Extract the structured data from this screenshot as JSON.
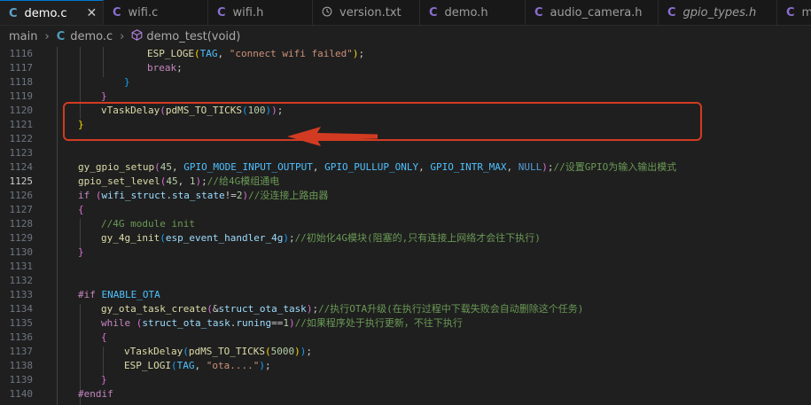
{
  "tabs": [
    {
      "icon": "C",
      "label": "demo.c",
      "active": true,
      "close": "✕",
      "italic": false,
      "width": 117
    },
    {
      "icon": "C",
      "label": "wifi.c",
      "active": false,
      "italic": false,
      "width": 118
    },
    {
      "icon": "C",
      "label": "wifi.h",
      "active": false,
      "italic": false,
      "width": 118
    },
    {
      "icon": "clock",
      "label": "version.txt",
      "active": false,
      "italic": false,
      "width": 121
    },
    {
      "icon": "C",
      "label": "demo.h",
      "active": false,
      "italic": false,
      "width": 119
    },
    {
      "icon": "C",
      "label": "audio_camera.h",
      "active": false,
      "italic": false,
      "width": 150
    },
    {
      "icon": "C",
      "label": "gpio_types.h",
      "active": false,
      "italic": true,
      "width": 134
    },
    {
      "icon": "C",
      "label": "m",
      "active": false,
      "italic": false,
      "width": 60
    }
  ],
  "breadcrumb": {
    "folder": "main",
    "file_icon": "C",
    "file": "demo.c",
    "symbol": "demo_test(void)"
  },
  "lines": [
    {
      "n": "1116",
      "indent": 3,
      "tokens": [
        [
          "fn",
          "ESP_LOGE"
        ],
        [
          "br1",
          "("
        ],
        [
          "mac",
          "TAG"
        ],
        [
          "txt",
          ", "
        ],
        [
          "str",
          "\"connect wifi failed\""
        ],
        [
          "br1",
          ")"
        ],
        [
          "txt",
          ";"
        ]
      ]
    },
    {
      "n": "1117",
      "indent": 3,
      "tokens": [
        [
          "kw",
          "break"
        ],
        [
          "txt",
          ";"
        ]
      ]
    },
    {
      "n": "1118",
      "indent": 2,
      "tokens": [
        [
          "br3",
          "}"
        ]
      ]
    },
    {
      "n": "1119",
      "indent": 1,
      "tokens": [
        [
          "br2",
          "}"
        ]
      ]
    },
    {
      "n": "1120",
      "indent": 1,
      "tokens": [
        [
          "fn",
          "vTaskDelay"
        ],
        [
          "br2",
          "("
        ],
        [
          "fn",
          "pdMS_TO_TICKS"
        ],
        [
          "br3",
          "("
        ],
        [
          "num",
          "100"
        ],
        [
          "br3",
          ")"
        ],
        [
          "br2",
          ")"
        ],
        [
          "txt",
          ";"
        ]
      ]
    },
    {
      "n": "1121",
      "indent": 0,
      "tokens": [
        [
          "br1",
          "}"
        ]
      ]
    },
    {
      "n": "1122",
      "indent": 0,
      "tokens": []
    },
    {
      "n": "1123",
      "indent": 0,
      "tokens": []
    },
    {
      "n": "1124",
      "indent": 0,
      "tokens": [
        [
          "fn",
          "gy_gpio_setup"
        ],
        [
          "br2",
          "("
        ],
        [
          "num",
          "45"
        ],
        [
          "txt",
          ", "
        ],
        [
          "mac",
          "GPIO_MODE_INPUT_OUTPUT"
        ],
        [
          "txt",
          ", "
        ],
        [
          "mac",
          "GPIO_PULLUP_ONLY"
        ],
        [
          "txt",
          ", "
        ],
        [
          "mac",
          "GPIO_INTR_MAX"
        ],
        [
          "txt",
          ", "
        ],
        [
          "kwb",
          "NULL"
        ],
        [
          "br2",
          ")"
        ],
        [
          "txt",
          ";"
        ],
        [
          "com",
          "//设置GPIO为输入输出模式"
        ]
      ]
    },
    {
      "n": "1125",
      "indent": 0,
      "current": true,
      "tokens": [
        [
          "fn",
          "gpio_set_level"
        ],
        [
          "br2",
          "("
        ],
        [
          "num",
          "45"
        ],
        [
          "txt",
          ", "
        ],
        [
          "num",
          "1"
        ],
        [
          "br2",
          ")"
        ],
        [
          "txt",
          ";"
        ],
        [
          "com",
          "//给4G模组通电"
        ]
      ]
    },
    {
      "n": "1126",
      "indent": 0,
      "tokens": [
        [
          "kw",
          "if"
        ],
        [
          "txt",
          " "
        ],
        [
          "br2",
          "("
        ],
        [
          "var",
          "wifi_struct"
        ],
        [
          "txt",
          "."
        ],
        [
          "var",
          "sta_state"
        ],
        [
          "txt",
          "!="
        ],
        [
          "num",
          "2"
        ],
        [
          "br2",
          ")"
        ],
        [
          "com",
          "//没连接上路由器"
        ]
      ]
    },
    {
      "n": "1127",
      "indent": 0,
      "tokens": [
        [
          "br2",
          "{"
        ]
      ]
    },
    {
      "n": "1128",
      "indent": 1,
      "tokens": [
        [
          "com",
          "//4G module init"
        ]
      ]
    },
    {
      "n": "1129",
      "indent": 1,
      "tokens": [
        [
          "fn",
          "gy_4g_init"
        ],
        [
          "br3",
          "("
        ],
        [
          "var",
          "esp_event_handler_4g"
        ],
        [
          "br3",
          ")"
        ],
        [
          "txt",
          ";"
        ],
        [
          "com",
          "//初始化4G模块(阻塞的,只有连接上网络才会往下执行)"
        ]
      ]
    },
    {
      "n": "1130",
      "indent": 0,
      "tokens": [
        [
          "br2",
          "}"
        ]
      ]
    },
    {
      "n": "1131",
      "indent": 0,
      "tokens": []
    },
    {
      "n": "1132",
      "indent": 0,
      "tokens": []
    },
    {
      "n": "1133",
      "indent": 0,
      "tokens": [
        [
          "kw",
          "#if"
        ],
        [
          "txt",
          " "
        ],
        [
          "mac",
          "ENABLE_OTA"
        ]
      ]
    },
    {
      "n": "1134",
      "indent": 1,
      "tokens": [
        [
          "fn",
          "gy_ota_task_create"
        ],
        [
          "br2",
          "("
        ],
        [
          "txt",
          "&"
        ],
        [
          "var",
          "struct_ota_task"
        ],
        [
          "br2",
          ")"
        ],
        [
          "txt",
          ";"
        ],
        [
          "com",
          "//执行OTA升级(在执行过程中下载失败会自动删除这个任务)"
        ]
      ]
    },
    {
      "n": "1135",
      "indent": 1,
      "tokens": [
        [
          "kw",
          "while"
        ],
        [
          "txt",
          " "
        ],
        [
          "br2",
          "("
        ],
        [
          "var",
          "struct_ota_task"
        ],
        [
          "txt",
          "."
        ],
        [
          "var",
          "runing"
        ],
        [
          "txt",
          "=="
        ],
        [
          "num",
          "1"
        ],
        [
          "br2",
          ")"
        ],
        [
          "com",
          "//如果程序处于执行更新，不往下执行"
        ]
      ]
    },
    {
      "n": "1136",
      "indent": 1,
      "tokens": [
        [
          "br2",
          "{"
        ]
      ]
    },
    {
      "n": "1137",
      "indent": 2,
      "tokens": [
        [
          "fn",
          "vTaskDelay"
        ],
        [
          "br3",
          "("
        ],
        [
          "fn",
          "pdMS_TO_TICKS"
        ],
        [
          "br1",
          "("
        ],
        [
          "num",
          "5000"
        ],
        [
          "br1",
          ")"
        ],
        [
          "br3",
          ")"
        ],
        [
          "txt",
          ";"
        ]
      ]
    },
    {
      "n": "1138",
      "indent": 2,
      "tokens": [
        [
          "fn",
          "ESP_LOGI"
        ],
        [
          "br3",
          "("
        ],
        [
          "mac",
          "TAG"
        ],
        [
          "txt",
          ", "
        ],
        [
          "str",
          "\"ota....\""
        ],
        [
          "br3",
          ")"
        ],
        [
          "txt",
          ";"
        ]
      ]
    },
    {
      "n": "1139",
      "indent": 1,
      "tokens": [
        [
          "br2",
          "}"
        ]
      ]
    },
    {
      "n": "1140",
      "indent": 0,
      "tokens": [
        [
          "kw",
          "#endif"
        ]
      ]
    }
  ]
}
